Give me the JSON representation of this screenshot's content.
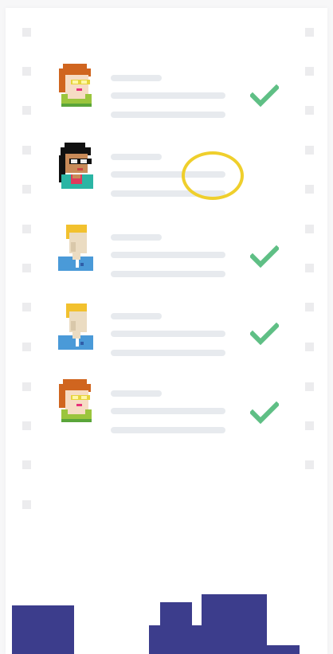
{
  "list": {
    "rows": [
      {
        "avatar": "redhead-woman-glasses-avatar",
        "status": "checked"
      },
      {
        "avatar": "black-hair-woman-glasses-avatar",
        "status": "pending-highlighted"
      },
      {
        "avatar": "blond-man-avatar",
        "status": "checked"
      },
      {
        "avatar": "blond-man-avatar",
        "status": "checked"
      },
      {
        "avatar": "redhead-woman-glasses-avatar",
        "status": "checked"
      }
    ]
  },
  "icons": {
    "check": "check-icon",
    "highlight": "highlight-circle-icon"
  },
  "colors": {
    "check": "#5fbf85",
    "skeleton_line": "#e7eaee",
    "highlight_ring": "#efcf2c",
    "skyline": "#3c3d8c",
    "perforation": "#ececee"
  }
}
